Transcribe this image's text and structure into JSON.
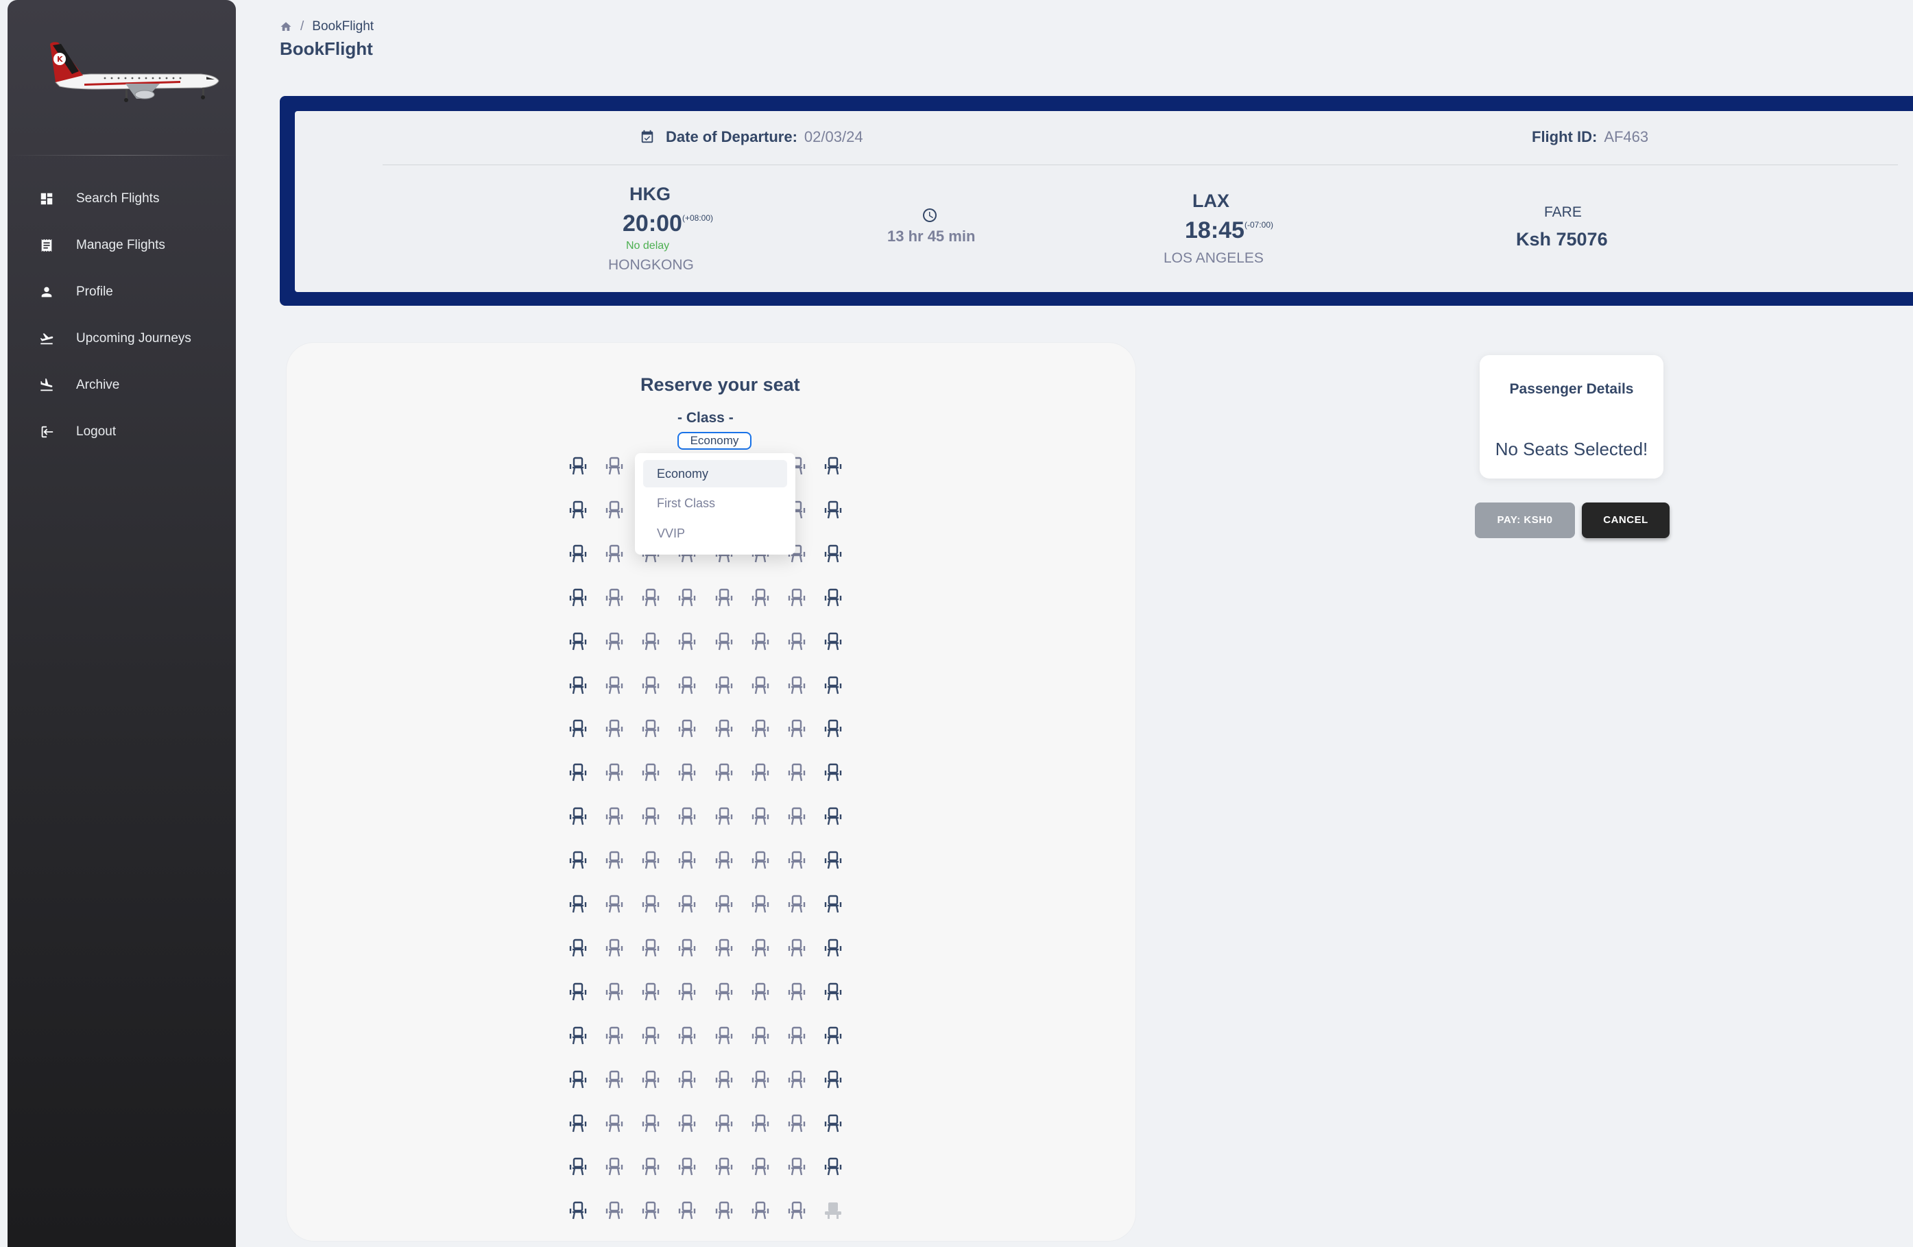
{
  "sidebar": {
    "items": [
      {
        "label": "Search Flights",
        "icon": "dashboard-icon"
      },
      {
        "label": "Manage Flights",
        "icon": "receipt-icon"
      },
      {
        "label": "Profile",
        "icon": "person-icon"
      },
      {
        "label": "Upcoming Journeys",
        "icon": "flight-takeoff-icon"
      },
      {
        "label": "Archive",
        "icon": "flight-land-icon"
      },
      {
        "label": "Logout",
        "icon": "logout-icon"
      }
    ]
  },
  "header": {
    "breadcrumb": {
      "separator": "/",
      "current": "BookFlight"
    },
    "title": "BookFlight"
  },
  "flight": {
    "departure_date_label": "Date of Departure:",
    "departure_date": "02/03/24",
    "flight_id_label": "Flight ID:",
    "flight_id": "AF463",
    "origin": {
      "code": "HKG",
      "time": "20:00",
      "tz": "(+08:00)",
      "status": "No delay",
      "city": "HONGKONG"
    },
    "duration": "13 hr 45 min",
    "destination": {
      "code": "LAX",
      "time": "18:45",
      "tz": "(-07:00)",
      "city": "LOS ANGELES"
    },
    "fare_label": "FARE",
    "fare": "Ksh 75076"
  },
  "seat_selection": {
    "title": "Reserve your seat",
    "class_label": "- Class -",
    "selected_class": "Economy",
    "class_options": [
      "Economy",
      "First Class",
      "VVIP"
    ],
    "rows": 18,
    "columns": 8,
    "disabled_seats": [
      [
        17,
        7
      ]
    ]
  },
  "passenger_details": {
    "title": "Passenger Details",
    "empty_message": "No Seats Selected!"
  },
  "actions": {
    "pay_label": "PAY: KSH0",
    "cancel_label": "CANCEL"
  },
  "colors": {
    "accent_navy": "#0b2570",
    "seat_window": "#344767",
    "seat_inner": "#7b809a",
    "seat_disabled": "#c4c7cc",
    "select_border": "#1a73e8",
    "no_delay": "#4caf50"
  }
}
